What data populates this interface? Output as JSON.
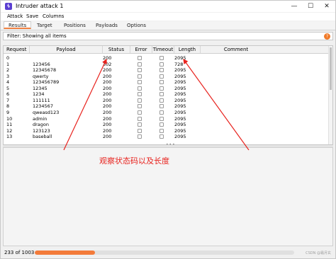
{
  "window": {
    "title": "Intruder attack 1",
    "app_icon": "burp-lightning-icon",
    "minimize": "—",
    "maximize": "☐",
    "close": "✕"
  },
  "menu": [
    "Attack",
    "Save",
    "Columns"
  ],
  "tabs": [
    {
      "label": "Results",
      "active": true
    },
    {
      "label": "Target",
      "active": false
    },
    {
      "label": "Positions",
      "active": false
    },
    {
      "label": "Payloads",
      "active": false
    },
    {
      "label": "Options",
      "active": false
    }
  ],
  "filter": {
    "text": "Filter: Showing all items",
    "help": "?"
  },
  "table": {
    "columns": [
      "Request",
      "Payload",
      "Status",
      "Error",
      "Timeout",
      "Length",
      "Comment"
    ],
    "rows": [
      {
        "request": "0",
        "payload": "",
        "status": "200",
        "length": "2095"
      },
      {
        "request": "1",
        "payload": "123456",
        "status": "302",
        "length": "728"
      },
      {
        "request": "2",
        "payload": "12345678",
        "status": "200",
        "length": "2095"
      },
      {
        "request": "3",
        "payload": "qwerty",
        "status": "200",
        "length": "2095"
      },
      {
        "request": "4",
        "payload": "123456789",
        "status": "200",
        "length": "2095"
      },
      {
        "request": "5",
        "payload": "12345",
        "status": "200",
        "length": "2095"
      },
      {
        "request": "6",
        "payload": "1234",
        "status": "200",
        "length": "2095"
      },
      {
        "request": "7",
        "payload": "111111",
        "status": "200",
        "length": "2095"
      },
      {
        "request": "8",
        "payload": "1234567",
        "status": "200",
        "length": "2095"
      },
      {
        "request": "9",
        "payload": "qweasd123",
        "status": "200",
        "length": "2095"
      },
      {
        "request": "10",
        "payload": "admin",
        "status": "200",
        "length": "2095"
      },
      {
        "request": "11",
        "payload": "dragon",
        "status": "200",
        "length": "2095"
      },
      {
        "request": "12",
        "payload": "123123",
        "status": "200",
        "length": "2095"
      },
      {
        "request": "13",
        "payload": "baseball",
        "status": "200",
        "length": "2095"
      }
    ]
  },
  "annotation": "观察状态码以及长度",
  "colors": {
    "annotation": "#e8231e",
    "progress": "#f37b3a",
    "tab_accent": "#f08040"
  },
  "status_bar": {
    "text": "233 of 1003",
    "progress": 0.232
  },
  "watermark": "CSDN @霜月玄"
}
